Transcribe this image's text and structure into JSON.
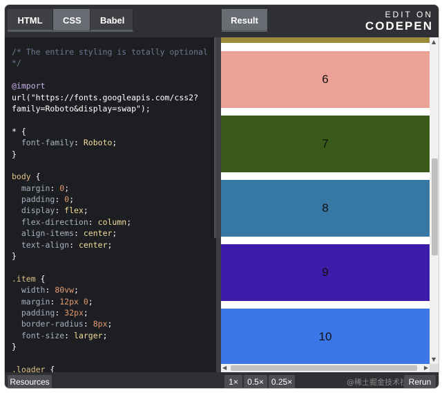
{
  "header": {
    "tabs": [
      {
        "label": "HTML",
        "active": false
      },
      {
        "label": "CSS",
        "active": true
      },
      {
        "label": "Babel",
        "active": false
      }
    ],
    "result_tab": "Result",
    "brand_top": "EDIT ON",
    "brand_name": "CODEPEN"
  },
  "code_lines": [
    [
      {
        "t": "/* The entire styling is totally optional",
        "c": "c-comment"
      }
    ],
    [
      {
        "t": "*/",
        "c": "c-comment"
      }
    ],
    [
      {
        "t": "",
        "c": ""
      }
    ],
    [
      {
        "t": "@import",
        "c": "c-at"
      }
    ],
    [
      {
        "t": "url(\"https://fonts.googleapis.com/css2?",
        "c": "c-str"
      }
    ],
    [
      {
        "t": "family=Roboto&display=swap\");",
        "c": "c-str"
      }
    ],
    [
      {
        "t": "",
        "c": ""
      }
    ],
    [
      {
        "t": "* {",
        "c": "c-str"
      }
    ],
    [
      {
        "t": "  font-family",
        "c": "c-prop"
      },
      {
        "t": ": ",
        "c": "c-str"
      },
      {
        "t": "Roboto",
        "c": "c-val"
      },
      {
        "t": ";",
        "c": "c-str"
      }
    ],
    [
      {
        "t": "}",
        "c": "c-str"
      }
    ],
    [
      {
        "t": "",
        "c": ""
      }
    ],
    [
      {
        "t": "body",
        "c": "c-sel"
      },
      {
        "t": " {",
        "c": "c-str"
      }
    ],
    [
      {
        "t": "  margin",
        "c": "c-prop"
      },
      {
        "t": ": ",
        "c": "c-str"
      },
      {
        "t": "0",
        "c": "c-num"
      },
      {
        "t": ";",
        "c": "c-str"
      }
    ],
    [
      {
        "t": "  padding",
        "c": "c-prop"
      },
      {
        "t": ": ",
        "c": "c-str"
      },
      {
        "t": "0",
        "c": "c-num"
      },
      {
        "t": ";",
        "c": "c-str"
      }
    ],
    [
      {
        "t": "  display",
        "c": "c-prop"
      },
      {
        "t": ": ",
        "c": "c-str"
      },
      {
        "t": "flex",
        "c": "c-val"
      },
      {
        "t": ";",
        "c": "c-str"
      }
    ],
    [
      {
        "t": "  flex-direction",
        "c": "c-prop"
      },
      {
        "t": ": ",
        "c": "c-str"
      },
      {
        "t": "column",
        "c": "c-val"
      },
      {
        "t": ";",
        "c": "c-str"
      }
    ],
    [
      {
        "t": "  align-items",
        "c": "c-prop"
      },
      {
        "t": ": ",
        "c": "c-str"
      },
      {
        "t": "center",
        "c": "c-val"
      },
      {
        "t": ";",
        "c": "c-str"
      }
    ],
    [
      {
        "t": "  text-align",
        "c": "c-prop"
      },
      {
        "t": ": ",
        "c": "c-str"
      },
      {
        "t": "center",
        "c": "c-val"
      },
      {
        "t": ";",
        "c": "c-str"
      }
    ],
    [
      {
        "t": "}",
        "c": "c-str"
      }
    ],
    [
      {
        "t": "",
        "c": ""
      }
    ],
    [
      {
        "t": ".item",
        "c": "c-sel"
      },
      {
        "t": " {",
        "c": "c-str"
      }
    ],
    [
      {
        "t": "  width",
        "c": "c-prop"
      },
      {
        "t": ": ",
        "c": "c-str"
      },
      {
        "t": "80vw",
        "c": "c-num"
      },
      {
        "t": ";",
        "c": "c-str"
      }
    ],
    [
      {
        "t": "  margin",
        "c": "c-prop"
      },
      {
        "t": ": ",
        "c": "c-str"
      },
      {
        "t": "12px 0",
        "c": "c-num"
      },
      {
        "t": ";",
        "c": "c-str"
      }
    ],
    [
      {
        "t": "  padding",
        "c": "c-prop"
      },
      {
        "t": ": ",
        "c": "c-str"
      },
      {
        "t": "32px",
        "c": "c-num"
      },
      {
        "t": ";",
        "c": "c-str"
      }
    ],
    [
      {
        "t": "  border-radius",
        "c": "c-prop"
      },
      {
        "t": ": ",
        "c": "c-str"
      },
      {
        "t": "8px",
        "c": "c-num"
      },
      {
        "t": ";",
        "c": "c-str"
      }
    ],
    [
      {
        "t": "  font-size",
        "c": "c-prop"
      },
      {
        "t": ": ",
        "c": "c-str"
      },
      {
        "t": "larger",
        "c": "c-val"
      },
      {
        "t": ";",
        "c": "c-str"
      }
    ],
    [
      {
        "t": "}",
        "c": "c-str"
      }
    ],
    [
      {
        "t": "",
        "c": ""
      }
    ],
    [
      {
        "t": ".loader",
        "c": "c-sel"
      },
      {
        "t": " {",
        "c": "c-str"
      }
    ]
  ],
  "result_items": [
    {
      "label": "6",
      "color": "#eba195"
    },
    {
      "label": "7",
      "color": "#3a5a19"
    },
    {
      "label": "8",
      "color": "#3777a3"
    },
    {
      "label": "9",
      "color": "#3c1ca8"
    },
    {
      "label": "10",
      "color": "#3c77e8"
    }
  ],
  "bottom": {
    "resources": "Resources",
    "zoom": [
      "1×",
      "0.5×",
      "0.25×"
    ],
    "rerun": "Rerun",
    "watermark": "@稀土掘金技术社区"
  }
}
